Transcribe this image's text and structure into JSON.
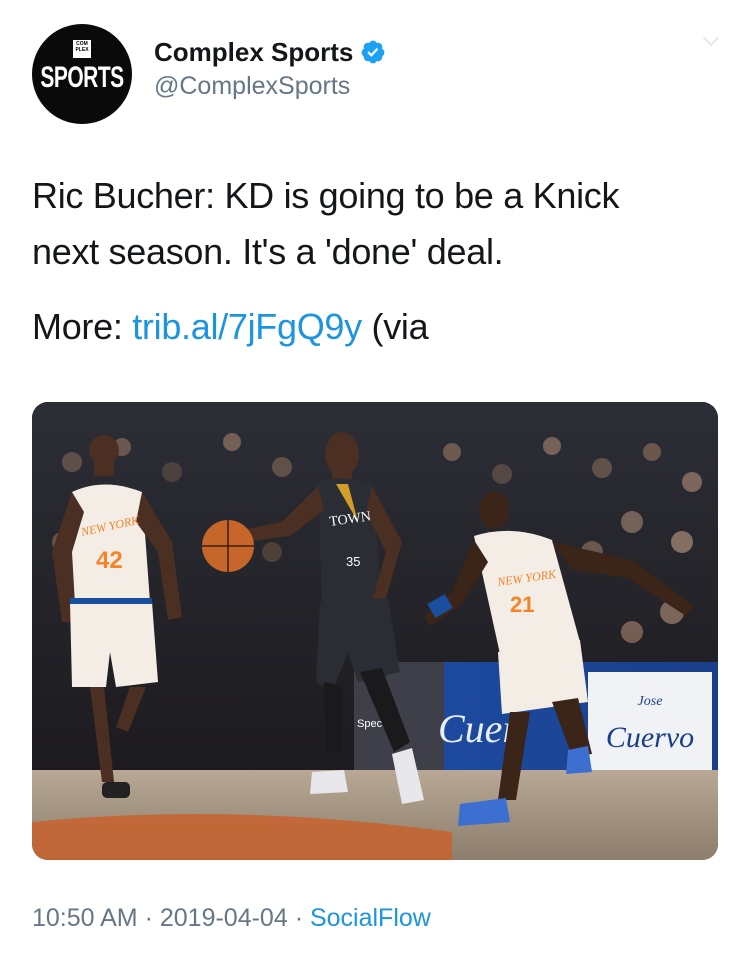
{
  "account": {
    "display_name": "Complex Sports",
    "handle": "@ComplexSports",
    "verified": true,
    "avatar_logo_small": "COM PLEX",
    "avatar_logo_word": "SPORTS"
  },
  "tweet": {
    "text_line1": "Ric Bucher: KD is going to be a Knick",
    "text_line2": "next season. It's a 'done' deal.",
    "more_prefix": "More: ",
    "link_text": "trib.al/7jFgQ9y",
    "more_suffix": " (via"
  },
  "media": {
    "jersey_left": "NEW YORK",
    "number_left": "42",
    "jersey_center": "TOWN",
    "number_center": "35",
    "jersey_right": "NEW YORK",
    "number_right": "21",
    "board_left": "Spectr",
    "board_mid": "Cuer",
    "board_right_top": "Jose",
    "board_right_bottom": "Cuervo"
  },
  "footer": {
    "time": "10:50 AM",
    "sep1": " · ",
    "date": "2019-04-04",
    "sep2": " · ",
    "source": "SocialFlow"
  },
  "colors": {
    "link": "#1b95e0",
    "secondary_text": "#657786",
    "verified_badge": "#1da1f2",
    "knicks_orange": "#f58426",
    "knicks_blue": "#006bb6",
    "warriors_gold": "#fdb927"
  },
  "icons": {
    "verified": "verified-badge-icon",
    "caret": "chevron-down-icon"
  }
}
